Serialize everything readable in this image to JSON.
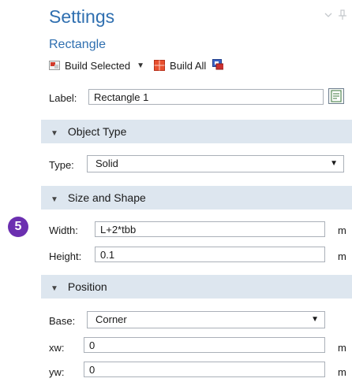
{
  "header": {
    "title": "Settings",
    "subtitle": "Rectangle"
  },
  "toolbar": {
    "build_selected": "Build Selected",
    "build_all": "Build All"
  },
  "label_row": {
    "label": "Label:",
    "value": "Rectangle 1"
  },
  "object_type": {
    "section_title": "Object Type",
    "type_label": "Type:",
    "type_value": "Solid"
  },
  "size_shape": {
    "section_title": "Size and Shape",
    "width_label": "Width:",
    "width_value": "L+2*tbb",
    "width_unit": "m",
    "height_label": "Height:",
    "height_value": "0.1",
    "height_unit": "m"
  },
  "position": {
    "section_title": "Position",
    "base_label": "Base:",
    "base_value": "Corner",
    "xw_label": "xw:",
    "xw_value": "0",
    "xw_unit": "m",
    "yw_label": "yw:",
    "yw_value": "0",
    "yw_unit": "m"
  },
  "step_badge": "5",
  "colors": {
    "accent": "#2f6fb0",
    "section_bg": "#dde6ef",
    "badge": "#6b2fb0"
  }
}
